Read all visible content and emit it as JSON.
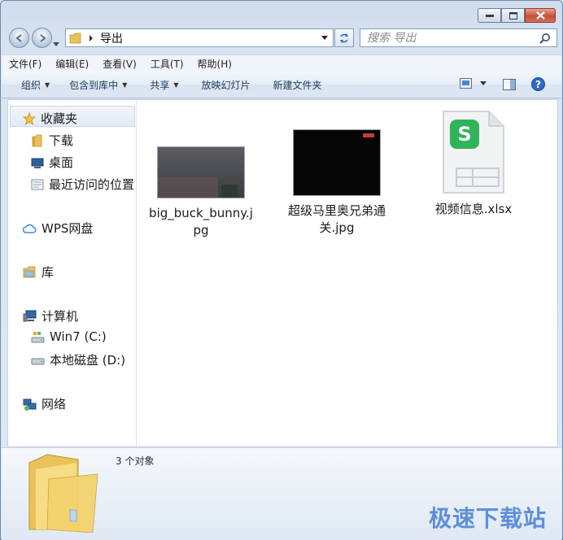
{
  "address": {
    "path": "导出"
  },
  "search": {
    "placeholder": "搜索 导出"
  },
  "menubar": {
    "items": [
      "文件(F)",
      "编辑(E)",
      "查看(V)",
      "工具(T)",
      "帮助(H)"
    ]
  },
  "toolbar": {
    "organize": "组织",
    "include_in_library": "包含到库中",
    "share": "共享",
    "slideshow": "放映幻灯片",
    "new_folder": "新建文件夹"
  },
  "nav": {
    "favorites": "收藏夹",
    "downloads": "下载",
    "desktop": "桌面",
    "recent": "最近访问的位置",
    "wps": "WPS网盘",
    "libraries": "库",
    "computer": "计算机",
    "drive_c": "Win7 (C:)",
    "drive_d": "本地磁盘 (D:)",
    "network": "网络"
  },
  "files": [
    {
      "name": "big_buck_bunny.jpg",
      "type": "image"
    },
    {
      "name": "超级马里奥兄弟通关.jpg",
      "type": "image"
    },
    {
      "name": "视频信息.xlsx",
      "type": "spreadsheet"
    }
  ],
  "status": {
    "count": "3 个对象"
  },
  "watermark": "极速下载站",
  "colors": {
    "accent": "#3a8ee6",
    "wps_green": "#2fb45a"
  }
}
